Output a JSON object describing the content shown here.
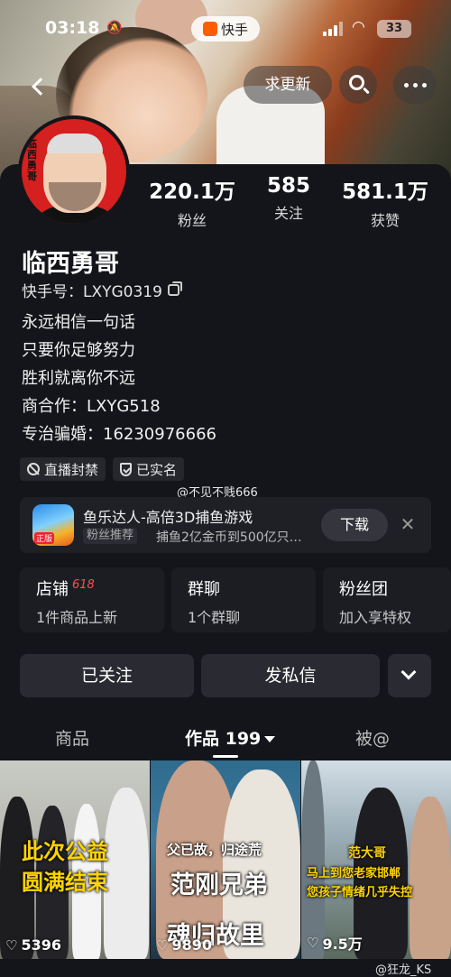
{
  "status_bar": {
    "time": "03:18",
    "app_name": "快手",
    "battery": "33"
  },
  "top_actions": {
    "urge_label": "求更新"
  },
  "profile": {
    "name": "临西勇哥",
    "kuaishou_id": "快手号：LXYG0319",
    "avatar_tag": "临西勇哥",
    "stats": [
      {
        "value": "220.1万",
        "label": "粉丝"
      },
      {
        "value": "585",
        "label": "关注"
      },
      {
        "value": "581.1万",
        "label": "获赞"
      }
    ],
    "bio_lines": [
      "永远相信一句话",
      "只要你足够努力",
      "胜利就离你不远",
      "商合作：LXYG518",
      "专治骗婚：16230976666"
    ],
    "badges": [
      "直播封禁",
      "已实名"
    ]
  },
  "watermarks": {
    "mid": "@不见不贱666",
    "bottom": "@狂龙_KS"
  },
  "ad": {
    "title": "鱼乐达人-高倍3D捕鱼游戏",
    "tag": "粉丝推荐",
    "description": "捕鱼2亿金币到500亿只…",
    "download_label": "下载",
    "close_symbol": "✕"
  },
  "cards": [
    {
      "title": "店铺",
      "highlight": "618",
      "subtitle": "1件商品上新"
    },
    {
      "title": "群聊",
      "subtitle": "1个群聊"
    },
    {
      "title": "粉丝团",
      "subtitle": "加入享特权"
    }
  ],
  "actions": {
    "follow_label": "已关注",
    "message_label": "发私信"
  },
  "tabs": [
    {
      "label": "商品"
    },
    {
      "label": "作品 199"
    },
    {
      "label": "被@"
    }
  ],
  "videos": [
    {
      "caption_lines": [
        "此次公益",
        "圆满结束"
      ],
      "likes": "5396"
    },
    {
      "caption_lines": [
        "父已故，归途荒",
        "范刚兄弟",
        "魂归故里"
      ],
      "likes": "9890"
    },
    {
      "caption_lines": [
        "范大哥",
        "马上到您老家邯郸",
        "您孩子情绪几乎失控"
      ],
      "likes": "9.5万"
    }
  ],
  "colors": {
    "background": "#14151a",
    "card": "#1c1d23",
    "button": "#2a2b32",
    "accent_red": "#ff4f4f",
    "caption_yellow": "#ffd400"
  }
}
